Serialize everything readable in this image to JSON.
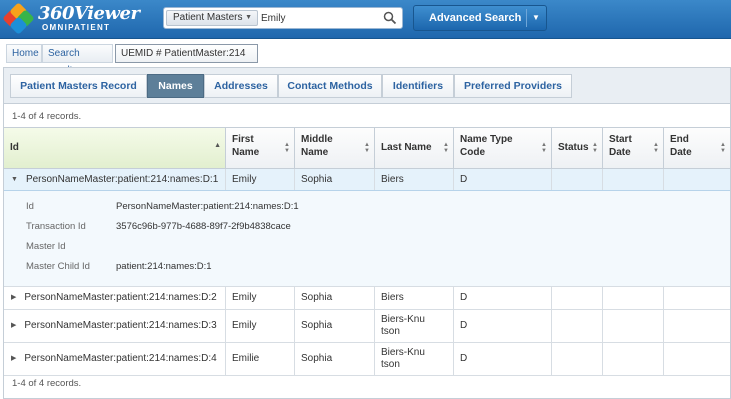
{
  "app": {
    "logo_title": "360Viewer",
    "logo_subtitle": "OMNIPATIENT",
    "brand_colors": [
      "#e8402e",
      "#f7a21b",
      "#38b44a",
      "#1d8fd8"
    ]
  },
  "search": {
    "scope": "Patient Masters",
    "query": "Emily",
    "advanced_label": "Advanced Search"
  },
  "breadcrumb": [
    "Home",
    "Search results",
    "UEMID # PatientMaster:214"
  ],
  "tabs": [
    "Patient Masters Record",
    "Names",
    "Addresses",
    "Contact Methods",
    "Identifiers",
    "Preferred Providers"
  ],
  "active_tab": "Names",
  "records_text": "1-4 of 4 records.",
  "table": {
    "columns": [
      "Id",
      "First Name",
      "Middle Name",
      "Last Name",
      "Name Type Code",
      "Status",
      "Start Date",
      "End Date"
    ],
    "rows": [
      {
        "id": "PersonNameMaster:patient:214:names:D:1",
        "first": "Emily",
        "middle": "Sophia",
        "last": "Biers",
        "type": "D",
        "status": "",
        "start": "",
        "end": "",
        "expanded": true
      },
      {
        "id": "PersonNameMaster:patient:214:names:D:2",
        "first": "Emily",
        "middle": "Sophia",
        "last": "Biers",
        "type": "D",
        "status": "",
        "start": "",
        "end": "",
        "expanded": false
      },
      {
        "id": "PersonNameMaster:patient:214:names:D:3",
        "first": "Emily",
        "middle": "Sophia",
        "last": "Biers-Knutson",
        "type": "D",
        "status": "",
        "start": "",
        "end": "",
        "expanded": false
      },
      {
        "id": "PersonNameMaster:patient:214:names:D:4",
        "first": "Emilie",
        "middle": "Sophia",
        "last": "Biers-Knutson",
        "type": "D",
        "status": "",
        "start": "",
        "end": "",
        "expanded": false
      }
    ]
  },
  "detail": {
    "fields": [
      {
        "label": "Id",
        "value": "PersonNameMaster:patient:214:names:D:1"
      },
      {
        "label": "Transaction Id",
        "value": "3576c96b-977b-4688-89f7-2f9b4838cace"
      },
      {
        "label": "Master Id",
        "value": ""
      },
      {
        "label": "Master Child Id",
        "value": "patient:214:names:D:1"
      }
    ]
  }
}
